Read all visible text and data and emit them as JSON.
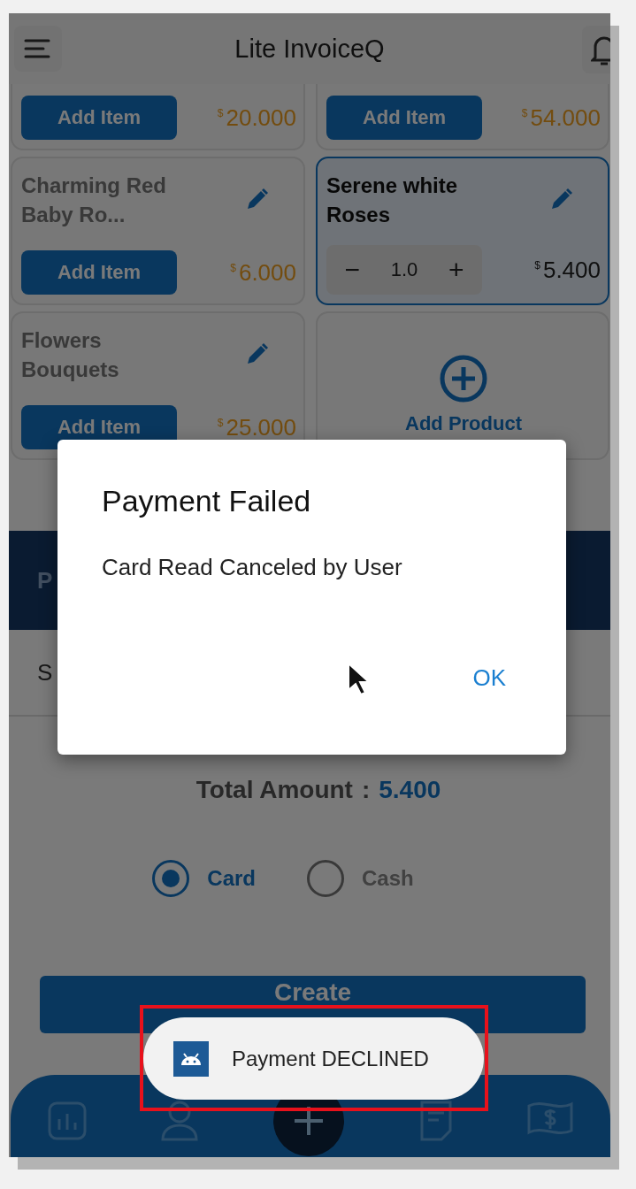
{
  "header": {
    "title": "Lite InvoiceQ"
  },
  "products": [
    {
      "kind": "add",
      "button": "Add Item",
      "currency": "$",
      "price": "20.000",
      "selected": false
    },
    {
      "kind": "add",
      "button": "Add Item",
      "currency": "$",
      "price": "54.000",
      "selected": false
    },
    {
      "kind": "add",
      "name": "Charming Red Baby Ro...",
      "button": "Add Item",
      "currency": "$",
      "price": "6.000",
      "selected": false
    },
    {
      "kind": "stepper",
      "name": "Serene white Roses",
      "decrement": "−",
      "quantity": "1.0",
      "increment": "+",
      "currency": "$",
      "price": "5.400",
      "selected": true
    },
    {
      "kind": "add",
      "name": "Flowers Bouquets",
      "button": "Add Item",
      "currency": "$",
      "price": "25.000",
      "selected": false
    }
  ],
  "add_product": {
    "label": "Add Product"
  },
  "section_band": {
    "title": "P"
  },
  "summary_row": {
    "label": "S"
  },
  "total": {
    "label": "Total Amount",
    "separator": ":",
    "amount": "5.400"
  },
  "payment_methods": [
    {
      "label": "Card",
      "selected": true
    },
    {
      "label": "Cash",
      "selected": false
    }
  ],
  "create_button": "Create",
  "dialog": {
    "title": "Payment Failed",
    "message": "Card Read Canceled by User",
    "button": "OK"
  },
  "toast": {
    "message": "Payment DECLINED",
    "highlighted": true
  }
}
